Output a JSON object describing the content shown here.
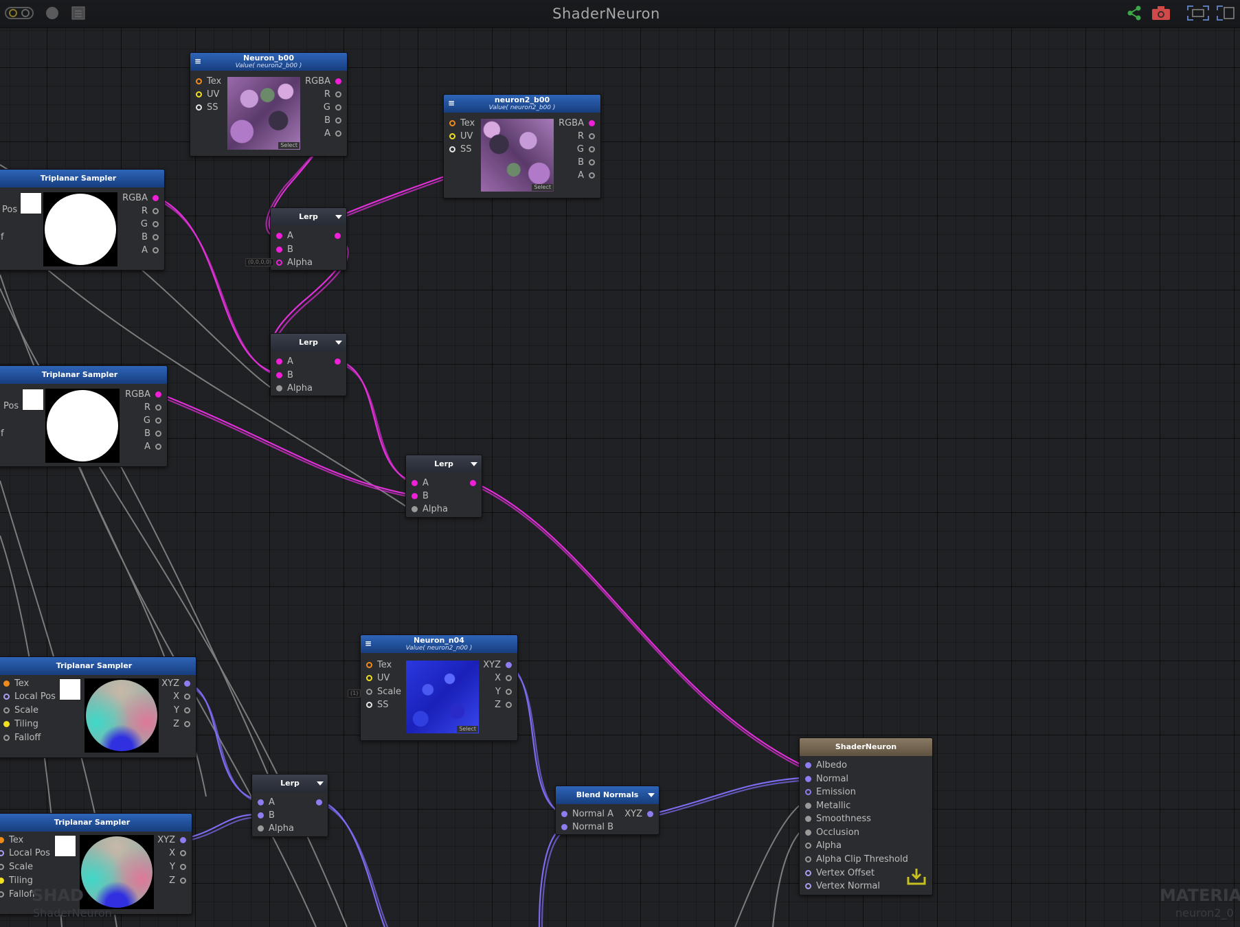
{
  "app_title": "ShaderNeuron",
  "toolbar": {
    "left_icons": [
      "toggle-icon",
      "circle-icon",
      "grid-icon"
    ],
    "right_icons": [
      "share-icon",
      "camera-icon",
      "fit-view-icon",
      "layout-icon"
    ]
  },
  "nodes": {
    "neuron_b00": {
      "title": "Neuron_b00",
      "subtitle": "Value( neuron2_b00 )",
      "inputs": [
        "Tex",
        "UV",
        "SS"
      ],
      "outputs": [
        "RGBA",
        "R",
        "G",
        "B",
        "A"
      ],
      "select": "Select"
    },
    "neuron2_b00": {
      "title": "neuron2_b00",
      "subtitle": "Value( neuron2_b00 )",
      "inputs": [
        "Tex",
        "UV",
        "SS"
      ],
      "outputs": [
        "RGBA",
        "R",
        "G",
        "B",
        "A"
      ],
      "select": "Select"
    },
    "triplanar1": {
      "title": "Triplanar Sampler",
      "inputs": [
        "Pos",
        "f"
      ],
      "outputs": [
        "RGBA",
        "R",
        "G",
        "B",
        "A"
      ]
    },
    "triplanar2": {
      "title": "Triplanar Sampler",
      "inputs": [
        "Pos",
        "f"
      ],
      "outputs": [
        "RGBA",
        "R",
        "G",
        "B",
        "A"
      ]
    },
    "lerp1": {
      "title": "Lerp",
      "inputs": [
        "A",
        "B",
        "Alpha"
      ],
      "alpha_value": "(0,0,0,0)"
    },
    "lerp2": {
      "title": "Lerp",
      "inputs": [
        "A",
        "B",
        "Alpha"
      ]
    },
    "lerp3": {
      "title": "Lerp",
      "inputs": [
        "A",
        "B",
        "Alpha"
      ]
    },
    "neuron_n04": {
      "title": "Neuron_n04",
      "subtitle": "Value( neuron2_n00 )",
      "inputs": [
        "Tex",
        "UV",
        "Scale",
        "SS"
      ],
      "outputs": [
        "XYZ",
        "X",
        "Y",
        "Z"
      ],
      "select": "Select",
      "scale_value": "(1)"
    },
    "triplanar3": {
      "title": "Triplanar Sampler",
      "inputs": [
        "Tex",
        "Local Pos",
        "Scale",
        "Tiling",
        "Falloff"
      ],
      "outputs": [
        "XYZ",
        "X",
        "Y",
        "Z"
      ]
    },
    "triplanar4": {
      "title": "Triplanar Sampler",
      "inputs": [
        "Tex",
        "Local Pos",
        "Scale",
        "Tiling",
        "Falloff"
      ],
      "outputs": [
        "XYZ",
        "X",
        "Y",
        "Z"
      ]
    },
    "lerp4": {
      "title": "Lerp",
      "inputs": [
        "A",
        "B",
        "Alpha"
      ]
    },
    "blend_normals": {
      "title": "Blend Normals",
      "inputs": [
        "Normal A",
        "Normal B"
      ],
      "outputs": [
        "XYZ"
      ]
    },
    "shader_neuron": {
      "title": "ShaderNeuron",
      "inputs": [
        "Albedo",
        "Normal",
        "Emission",
        "Metallic",
        "Smoothness",
        "Occlusion",
        "Alpha",
        "Alpha Clip Threshold",
        "Vertex Offset",
        "Vertex Normal"
      ],
      "save_icon": "download-icon"
    }
  },
  "watermark": {
    "left_title": "SHAD",
    "left_sub": "ShaderNeuron",
    "right_title": "MATERIAL",
    "right_sub": "neuron2_0"
  },
  "colors": {
    "magenta_wire": "#e030d8",
    "blue_wire": "#7b6cf0",
    "gray_wire": "#8c8c8c",
    "node_header": "#2e64b8",
    "master_header": "#8a7a64"
  }
}
